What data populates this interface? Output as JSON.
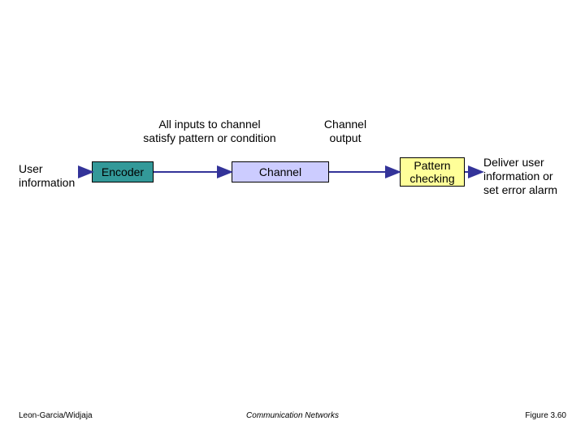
{
  "annotations": {
    "left": "All inputs to channel\nsatisfy pattern or condition",
    "right": "Channel\noutput"
  },
  "inputs": {
    "user_info": "User\ninformation",
    "output_info": "Deliver user\ninformation or\nset error alarm"
  },
  "boxes": {
    "encoder": "Encoder",
    "channel": "Channel",
    "pattern": "Pattern\nchecking"
  },
  "footer": {
    "left": "Leon-Garcia/Widjaja",
    "center": "Communication Networks",
    "right": "Figure 3.60"
  },
  "colors": {
    "encoder_fill": "#339999",
    "channel_fill": "#ccccff",
    "pattern_fill": "#ffff99",
    "arrow": "#333399"
  }
}
